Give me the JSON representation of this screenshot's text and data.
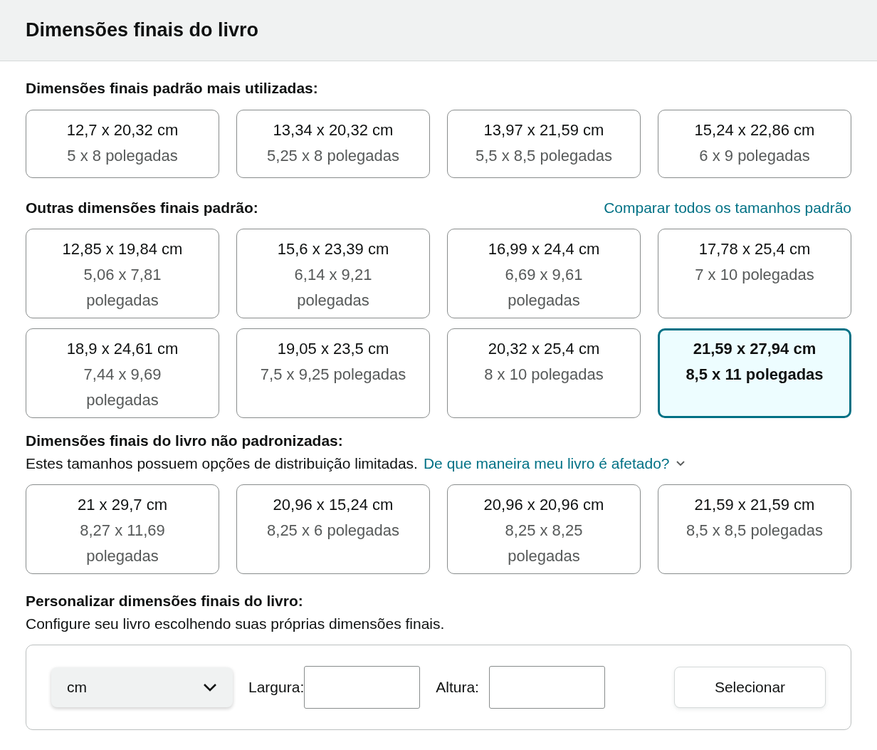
{
  "header": {
    "title": "Dimensões finais do livro"
  },
  "popular": {
    "heading": "Dimensões finais padrão mais utilizadas:",
    "sizes": [
      {
        "cm": "12,7 x 20,32 cm",
        "inches": "5 x 8 polegadas",
        "wrapped": false,
        "selected": false
      },
      {
        "cm": "13,34 x 20,32 cm",
        "inches": "5,25 x 8 polegadas",
        "wrapped": false,
        "selected": false
      },
      {
        "cm": "13,97 x 21,59 cm",
        "inches": "5,5 x 8,5 polegadas",
        "wrapped": false,
        "selected": false
      },
      {
        "cm": "15,24 x 22,86 cm",
        "inches": "6 x 9 polegadas",
        "wrapped": false,
        "selected": false
      }
    ]
  },
  "other": {
    "heading": "Outras dimensões finais padrão:",
    "link": "Comparar todos os tamanhos padrão",
    "sizes": [
      {
        "cm": "12,85 x 19,84 cm",
        "inches": "5,06 x 7,81 polegadas",
        "wrapped": true,
        "selected": false
      },
      {
        "cm": "15,6 x 23,39 cm",
        "inches": "6,14 x 9,21 polegadas",
        "wrapped": true,
        "selected": false
      },
      {
        "cm": "16,99 x 24,4 cm",
        "inches": "6,69 x 9,61 polegadas",
        "wrapped": true,
        "selected": false
      },
      {
        "cm": "17,78 x 25,4 cm",
        "inches": "7 x 10 polegadas",
        "wrapped": false,
        "selected": false
      },
      {
        "cm": "18,9 x 24,61 cm",
        "inches": "7,44 x 9,69 polegadas",
        "wrapped": true,
        "selected": false
      },
      {
        "cm": "19,05 x 23,5 cm",
        "inches": "7,5 x 9,25 polegadas",
        "wrapped": false,
        "selected": false
      },
      {
        "cm": "20,32 x 25,4 cm",
        "inches": "8 x 10 polegadas",
        "wrapped": false,
        "selected": false
      },
      {
        "cm": "21,59 x 27,94 cm",
        "inches": "8,5 x 11 polegadas",
        "wrapped": false,
        "selected": true
      }
    ]
  },
  "nonstandard": {
    "heading": "Dimensões finais do livro não padronizadas:",
    "note": "Estes tamanhos possuem opções de distribuição limitadas.",
    "link": "De que maneira meu livro é afetado?",
    "sizes": [
      {
        "cm": "21 x 29,7 cm",
        "inches": "8,27 x 11,69 polegadas",
        "wrapped": true,
        "selected": false
      },
      {
        "cm": "20,96 x 15,24 cm",
        "inches": "8,25 x 6 polegadas",
        "wrapped": false,
        "selected": false
      },
      {
        "cm": "20,96 x 20,96 cm",
        "inches": "8,25 x 8,25 polegadas",
        "wrapped": true,
        "selected": false
      },
      {
        "cm": "21,59 x 21,59 cm",
        "inches": "8,5 x 8,5 polegadas",
        "wrapped": false,
        "selected": false
      }
    ]
  },
  "custom": {
    "heading": "Personalizar dimensões finais do livro:",
    "note": "Configure seu livro escolhendo suas próprias dimensões finais.",
    "unit": "cm",
    "width_label": "Largura:",
    "height_label": "Altura:",
    "button": "Selecionar"
  }
}
